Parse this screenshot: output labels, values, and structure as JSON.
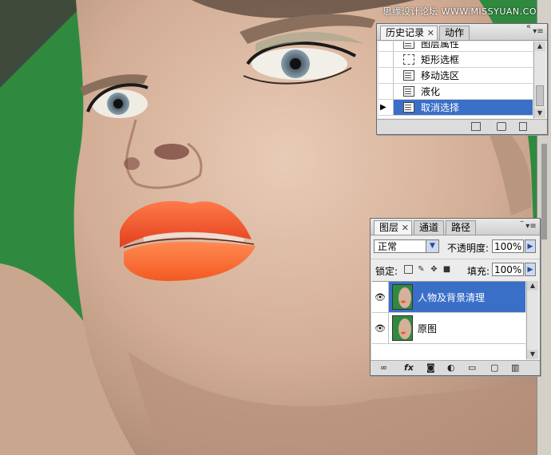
{
  "watermark": "思缘设计论坛 WWW.MISSYUAN.COM",
  "history_panel": {
    "tabs": [
      {
        "label": "历史记录",
        "active": true
      },
      {
        "label": "动作",
        "active": false
      }
    ],
    "items": [
      {
        "label": "图层属性",
        "icon": "document-icon",
        "selected": false
      },
      {
        "label": "矩形选框",
        "icon": "marquee-icon",
        "selected": false
      },
      {
        "label": "移动选区",
        "icon": "document-icon",
        "selected": false
      },
      {
        "label": "液化",
        "icon": "document-icon",
        "selected": false
      },
      {
        "label": "取消选择",
        "icon": "document-icon",
        "selected": true
      }
    ],
    "footer_icons": [
      "new-document-from-state-icon",
      "snapshot-camera-icon",
      "trash-icon"
    ]
  },
  "layers_panel": {
    "tabs": [
      {
        "label": "图层",
        "active": true
      },
      {
        "label": "通道",
        "active": false
      },
      {
        "label": "路径",
        "active": false
      }
    ],
    "blend_mode": "正常",
    "opacity_label": "不透明度:",
    "opacity_value": "100%",
    "lock_label": "锁定:",
    "fill_label": "填充:",
    "fill_value": "100%",
    "layers": [
      {
        "name": "人物及背景清理",
        "visible": true,
        "selected": true
      },
      {
        "name": "原图",
        "visible": true,
        "selected": false
      }
    ],
    "footer_icons": [
      "link-layers-icon",
      "fx-icon",
      "add-mask-icon",
      "adjustment-layer-icon",
      "group-folder-icon",
      "new-layer-icon",
      "trash-icon"
    ],
    "footer_fx": "fx"
  },
  "colors": {
    "background_green": "#2f8a40",
    "selection_blue": "#3a6fc8",
    "lip_orange": "#f4552a",
    "skin": "#d9b8a2"
  }
}
